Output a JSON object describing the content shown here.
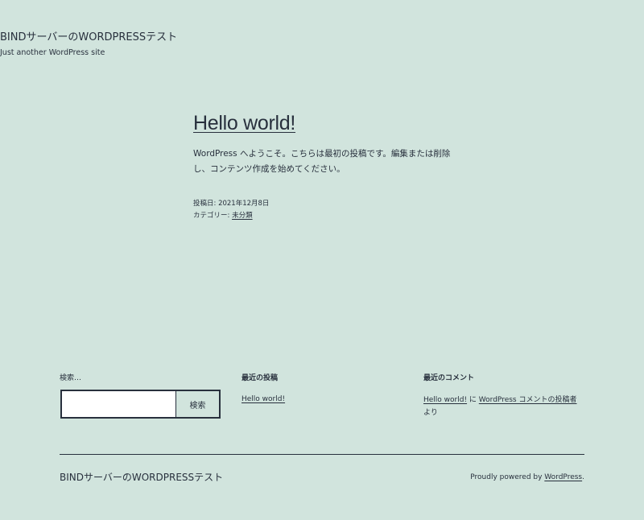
{
  "header": {
    "site_title": "BINDサーバーのWORDPRESSテスト",
    "tagline": "Just another WordPress site"
  },
  "post": {
    "title": "Hello world!",
    "content": "WordPress へようこそ。こちらは最初の投稿です。編集または削除し、コンテンツ作成を始めてください。",
    "posted_label": "投稿日:",
    "posted_date": "2021年12月8日",
    "category_label": "カテゴリー:",
    "category": "未分類"
  },
  "widgets": {
    "search": {
      "label": "検索…",
      "value": "",
      "button": "検索"
    },
    "recent_posts": {
      "heading": "最近の投稿",
      "items": [
        "Hello world!"
      ]
    },
    "recent_comments": {
      "heading": "最近のコメント",
      "post_link": "Hello world!",
      "connector": " に ",
      "author_link": "WordPress コメントの投稿者",
      "suffix": "より"
    }
  },
  "footer": {
    "site_title": "BINDサーバーのWORDPRESSテスト",
    "powered_prefix": "Proudly powered by ",
    "powered_link": "WordPress",
    "powered_suffix": "."
  },
  "colors": {
    "background": "#d1e4dd",
    "text": "#28303d"
  }
}
